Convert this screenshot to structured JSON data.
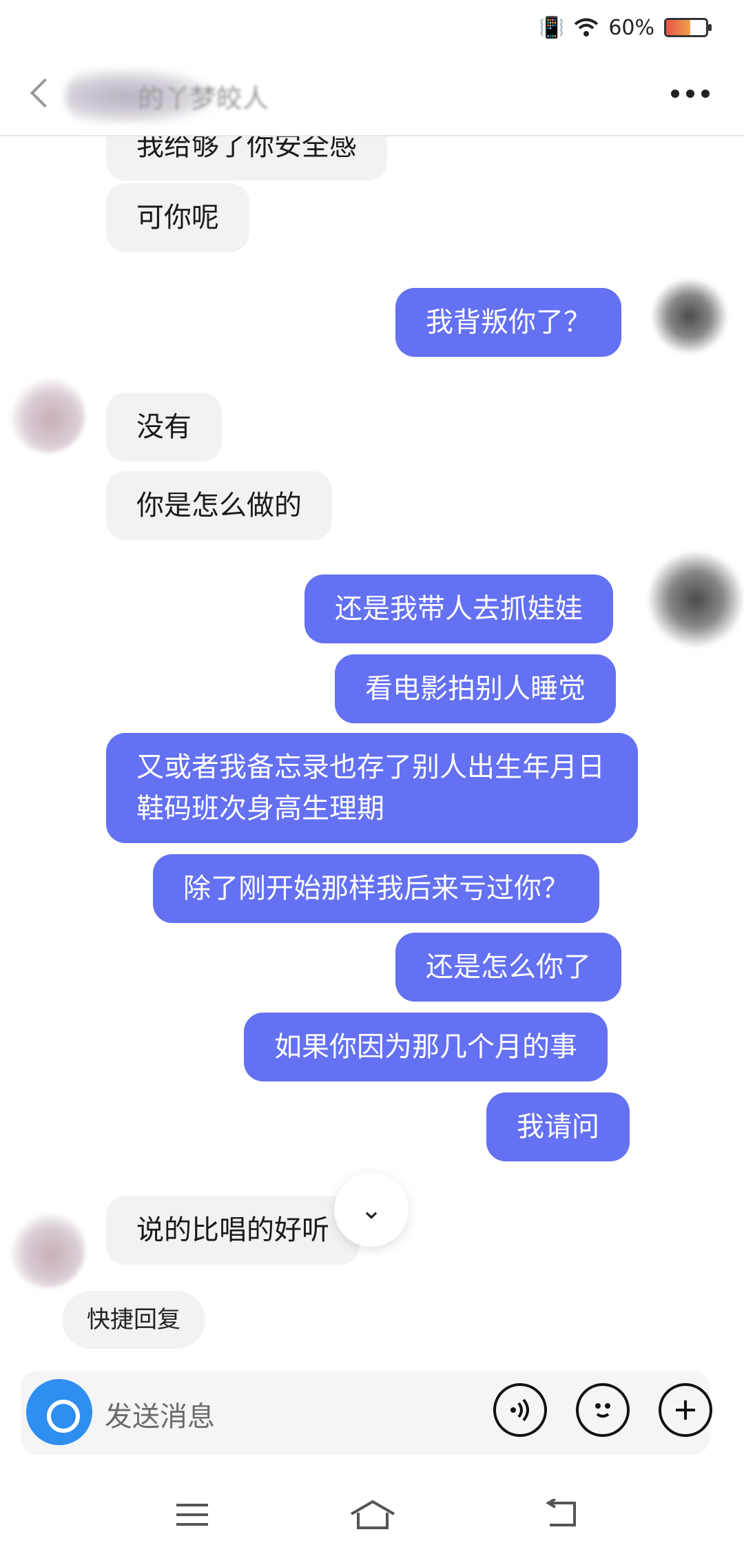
{
  "status_bar": {
    "battery_percent": "60%",
    "battery_level": 0.6,
    "battery_color": "#f0a24a"
  },
  "header": {
    "title": "的丫梦皎人",
    "more_icon": "more-horizontal-icon",
    "back_icon": "chevron-left-icon"
  },
  "messages": [
    {
      "side": "in",
      "text": "我给够了你安全感"
    },
    {
      "side": "in",
      "text": "可你呢"
    },
    {
      "side": "out",
      "text": "我背叛你了？"
    },
    {
      "side": "in",
      "text": "没有"
    },
    {
      "side": "in",
      "text": "你是怎么做的"
    },
    {
      "side": "out",
      "text": "还是我带人去抓娃娃"
    },
    {
      "side": "out",
      "text": "看电影拍别人睡觉"
    },
    {
      "side": "out",
      "text": "又或者我备忘录也存了别人出生年月日鞋码班次身高生理期"
    },
    {
      "side": "out",
      "text": "除了刚开始那样我后来亏过你？"
    },
    {
      "side": "out",
      "text": "还是怎么你了"
    },
    {
      "side": "out",
      "text": "如果你因为那几个月的事"
    },
    {
      "side": "out",
      "text": "我请问"
    },
    {
      "side": "in",
      "text": "说的比唱的好听"
    }
  ],
  "quick_reply": {
    "label": "快捷回复"
  },
  "input": {
    "placeholder": "发送消息",
    "icons": [
      "camera-icon",
      "voice-icon",
      "emoji-icon",
      "plus-icon"
    ]
  },
  "colors": {
    "outgoing_bubble": "#6471f2",
    "incoming_bubble": "#f2f2f2",
    "accent": "#2f8ff0"
  }
}
